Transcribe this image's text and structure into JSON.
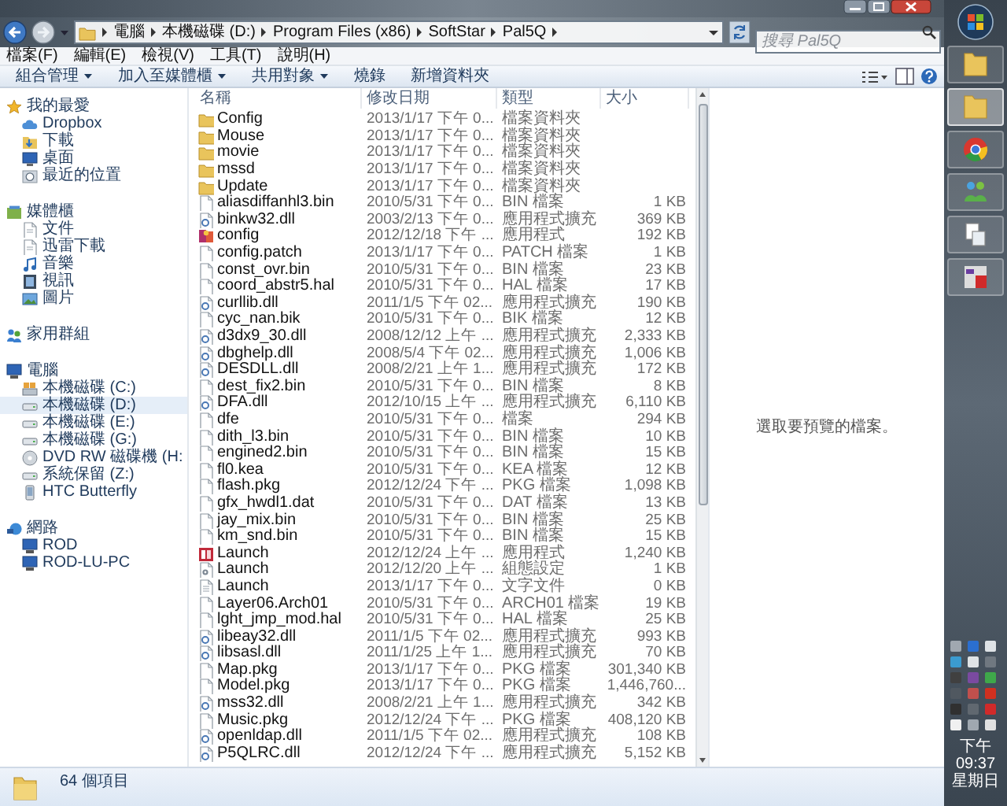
{
  "address_bar": {
    "path": [
      "電腦",
      "本機磁碟 (D:)",
      "Program Files (x86)",
      "SoftStar",
      "Pal5Q"
    ]
  },
  "search": {
    "placeholder": "搜尋 Pal5Q"
  },
  "menu": [
    "檔案(F)",
    "編輯(E)",
    "檢視(V)",
    "工具(T)",
    "說明(H)"
  ],
  "commands": [
    {
      "label": "組合管理",
      "dropdown": true
    },
    {
      "label": "加入至媒體櫃",
      "dropdown": true
    },
    {
      "label": "共用對象",
      "dropdown": true
    },
    {
      "label": "燒錄",
      "dropdown": false
    },
    {
      "label": "新增資料夾",
      "dropdown": false
    }
  ],
  "sidebar": {
    "groups": [
      {
        "label": "我的最愛",
        "kind": "star",
        "selected": false,
        "children": [
          {
            "label": "Dropbox",
            "kind": "cloud",
            "selected": false
          },
          {
            "label": "下載",
            "kind": "download",
            "selected": false
          },
          {
            "label": "桌面",
            "kind": "desktop",
            "selected": false
          },
          {
            "label": "最近的位置",
            "kind": "recent",
            "selected": false
          }
        ]
      },
      {
        "label": "媒體櫃",
        "kind": "library",
        "selected": false,
        "children": [
          {
            "label": "文件",
            "kind": "document",
            "selected": false
          },
          {
            "label": "迅雷下載",
            "kind": "document",
            "selected": false
          },
          {
            "label": "音樂",
            "kind": "music",
            "selected": false
          },
          {
            "label": "視訊",
            "kind": "video",
            "selected": false
          },
          {
            "label": "圖片",
            "kind": "picture",
            "selected": false
          }
        ]
      },
      {
        "label": "家用群組",
        "kind": "homegroup",
        "selected": false
      },
      {
        "label": "電腦",
        "kind": "computer",
        "selected": false,
        "children": [
          {
            "label": "本機磁碟 (C:)",
            "kind": "system-drive",
            "selected": false
          },
          {
            "label": "本機磁碟 (D:)",
            "kind": "drive",
            "selected": true
          },
          {
            "label": "本機磁碟 (E:)",
            "kind": "drive",
            "selected": false
          },
          {
            "label": "本機磁碟 (G:)",
            "kind": "drive",
            "selected": false
          },
          {
            "label": "DVD RW 磁碟機 (H:",
            "kind": "dvd",
            "selected": false
          },
          {
            "label": "系統保留 (Z:)",
            "kind": "drive",
            "selected": false
          },
          {
            "label": "HTC Butterfly",
            "kind": "phone",
            "selected": false
          }
        ]
      },
      {
        "label": "網路",
        "kind": "network",
        "selected": false,
        "children": [
          {
            "label": "ROD",
            "kind": "pc",
            "selected": false
          },
          {
            "label": "ROD-LU-PC",
            "kind": "pc",
            "selected": false
          }
        ]
      }
    ]
  },
  "table": {
    "columns": [
      "名稱",
      "修改日期",
      "類型",
      "大小"
    ],
    "rows": [
      {
        "kind": "folder",
        "name": "Config",
        "date": "2013/1/17 下午 0...",
        "type": "檔案資料夾",
        "size": ""
      },
      {
        "kind": "folder",
        "name": "Mouse",
        "date": "2013/1/17 下午 0...",
        "type": "檔案資料夾",
        "size": ""
      },
      {
        "kind": "folder",
        "name": "movie",
        "date": "2013/1/17 下午 0...",
        "type": "檔案資料夾",
        "size": ""
      },
      {
        "kind": "folder",
        "name": "mssd",
        "date": "2013/1/17 下午 0...",
        "type": "檔案資料夾",
        "size": ""
      },
      {
        "kind": "folder",
        "name": "Update",
        "date": "2013/1/17 下午 0...",
        "type": "檔案資料夾",
        "size": ""
      },
      {
        "kind": "file",
        "name": "aliasdiffanhl3.bin",
        "date": "2010/5/31 下午 0...",
        "type": "BIN 檔案",
        "size": "1 KB"
      },
      {
        "kind": "dll",
        "name": "binkw32.dll",
        "date": "2003/2/13 下午 0...",
        "type": "應用程式擴充",
        "size": "369 KB"
      },
      {
        "kind": "app",
        "name": "config",
        "date": "2012/12/18 下午 ...",
        "type": "應用程式",
        "size": "192 KB"
      },
      {
        "kind": "file",
        "name": "config.patch",
        "date": "2013/1/17 下午 0...",
        "type": "PATCH 檔案",
        "size": "1 KB"
      },
      {
        "kind": "file",
        "name": "const_ovr.bin",
        "date": "2010/5/31 下午 0...",
        "type": "BIN 檔案",
        "size": "23 KB"
      },
      {
        "kind": "file",
        "name": "coord_abstr5.hal",
        "date": "2010/5/31 下午 0...",
        "type": "HAL 檔案",
        "size": "17 KB"
      },
      {
        "kind": "dll",
        "name": "curllib.dll",
        "date": "2011/1/5 下午 02...",
        "type": "應用程式擴充",
        "size": "190 KB"
      },
      {
        "kind": "file",
        "name": "cyc_nan.bik",
        "date": "2010/5/31 下午 0...",
        "type": "BIK 檔案",
        "size": "12 KB"
      },
      {
        "kind": "dll",
        "name": "d3dx9_30.dll",
        "date": "2008/12/12 上午 ...",
        "type": "應用程式擴充",
        "size": "2,333 KB"
      },
      {
        "kind": "dll",
        "name": "dbghelp.dll",
        "date": "2008/5/4 下午 02...",
        "type": "應用程式擴充",
        "size": "1,006 KB"
      },
      {
        "kind": "dll",
        "name": "DESDLL.dll",
        "date": "2008/2/21 上午 1...",
        "type": "應用程式擴充",
        "size": "172 KB"
      },
      {
        "kind": "file",
        "name": "dest_fix2.bin",
        "date": "2010/5/31 下午 0...",
        "type": "BIN 檔案",
        "size": "8 KB"
      },
      {
        "kind": "dll",
        "name": "DFA.dll",
        "date": "2012/10/15 上午 ...",
        "type": "應用程式擴充",
        "size": "6,110 KB"
      },
      {
        "kind": "file",
        "name": "dfe",
        "date": "2010/5/31 下午 0...",
        "type": "檔案",
        "size": "294 KB"
      },
      {
        "kind": "file",
        "name": "dith_l3.bin",
        "date": "2010/5/31 下午 0...",
        "type": "BIN 檔案",
        "size": "10 KB"
      },
      {
        "kind": "file",
        "name": "engined2.bin",
        "date": "2010/5/31 下午 0...",
        "type": "BIN 檔案",
        "size": "15 KB"
      },
      {
        "kind": "file",
        "name": "fl0.kea",
        "date": "2010/5/31 下午 0...",
        "type": "KEA 檔案",
        "size": "12 KB"
      },
      {
        "kind": "file",
        "name": "flash.pkg",
        "date": "2012/12/24 下午 ...",
        "type": "PKG 檔案",
        "size": "1,098 KB"
      },
      {
        "kind": "file",
        "name": "gfx_hwdl1.dat",
        "date": "2010/5/31 下午 0...",
        "type": "DAT 檔案",
        "size": "13 KB"
      },
      {
        "kind": "file",
        "name": "jay_mix.bin",
        "date": "2010/5/31 下午 0...",
        "type": "BIN 檔案",
        "size": "25 KB"
      },
      {
        "kind": "file",
        "name": "km_snd.bin",
        "date": "2010/5/31 下午 0...",
        "type": "BIN 檔案",
        "size": "15 KB"
      },
      {
        "kind": "launcher",
        "name": "Launch",
        "date": "2012/12/24 上午 ...",
        "type": "應用程式",
        "size": "1,240 KB"
      },
      {
        "kind": "settings",
        "name": "Launch",
        "date": "2012/12/20 上午 ...",
        "type": "組態設定",
        "size": "1 KB"
      },
      {
        "kind": "text",
        "name": "Launch",
        "date": "2013/1/17 下午 0...",
        "type": "文字文件",
        "size": "0 KB"
      },
      {
        "kind": "file",
        "name": "Layer06.Arch01",
        "date": "2010/5/31 下午 0...",
        "type": "ARCH01 檔案",
        "size": "19 KB"
      },
      {
        "kind": "file",
        "name": "lght_jmp_mod.hal",
        "date": "2010/5/31 下午 0...",
        "type": "HAL 檔案",
        "size": "25 KB"
      },
      {
        "kind": "dll",
        "name": "libeay32.dll",
        "date": "2011/1/5 下午 02...",
        "type": "應用程式擴充",
        "size": "993 KB"
      },
      {
        "kind": "dll",
        "name": "libsasl.dll",
        "date": "2011/1/25 上午 1...",
        "type": "應用程式擴充",
        "size": "70 KB"
      },
      {
        "kind": "file",
        "name": "Map.pkg",
        "date": "2013/1/17 下午 0...",
        "type": "PKG 檔案",
        "size": "301,340 KB"
      },
      {
        "kind": "file",
        "name": "Model.pkg",
        "date": "2013/1/17 下午 0...",
        "type": "PKG 檔案",
        "size": "1,446,760..."
      },
      {
        "kind": "dll",
        "name": "mss32.dll",
        "date": "2008/2/21 上午 1...",
        "type": "應用程式擴充",
        "size": "342 KB"
      },
      {
        "kind": "file",
        "name": "Music.pkg",
        "date": "2012/12/24 下午 ...",
        "type": "PKG 檔案",
        "size": "408,120 KB"
      },
      {
        "kind": "dll",
        "name": "openldap.dll",
        "date": "2011/1/5 下午 02...",
        "type": "應用程式擴充",
        "size": "108 KB"
      },
      {
        "kind": "dll",
        "name": "P5QLRC.dll",
        "date": "2012/12/24 下午 ...",
        "type": "應用程式擴充",
        "size": "5,152 KB"
      }
    ]
  },
  "preview": {
    "message": "選取要預覽的檔案。"
  },
  "status_bar": {
    "count": "64 個項目"
  },
  "taskbar": {
    "apps": [
      {
        "kind": "folder",
        "selected": false
      },
      {
        "kind": "folder",
        "selected": true
      },
      {
        "kind": "browser",
        "selected": false
      },
      {
        "kind": "people",
        "selected": false
      },
      {
        "kind": "documents",
        "selected": false
      },
      {
        "kind": "app",
        "selected": false
      }
    ],
    "clock": {
      "time": "下午 09:37",
      "day": "星期日"
    }
  }
}
